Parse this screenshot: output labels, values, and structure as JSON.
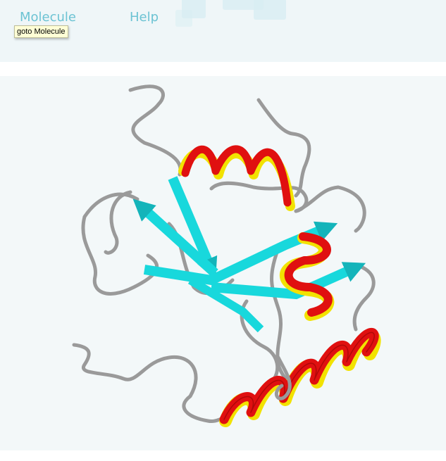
{
  "nav": {
    "molecule_label": "Molecule",
    "help_label": "Help"
  },
  "tooltip": {
    "text": "goto Molecule"
  },
  "viewer": {
    "subject": "protein ribbon structure",
    "colors": {
      "coil": "#9a9a9a",
      "helix_outer": "#e01010",
      "helix_inner": "#f2e200",
      "strand": "#18d8dc"
    }
  }
}
